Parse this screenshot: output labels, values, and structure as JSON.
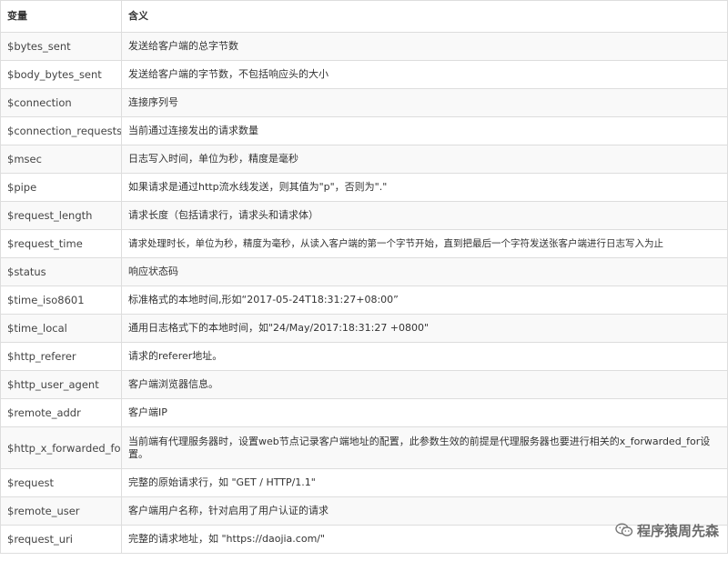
{
  "header": {
    "col1": "变量",
    "col2": "含义"
  },
  "rows": [
    {
      "var": "$bytes_sent",
      "desc": "发送给客户端的总字节数"
    },
    {
      "var": "$body_bytes_sent",
      "desc": "发送给客户端的字节数，不包括响应头的大小"
    },
    {
      "var": "$connection",
      "desc": "连接序列号"
    },
    {
      "var": "$connection_requests",
      "desc": "当前通过连接发出的请求数量"
    },
    {
      "var": "$msec",
      "desc": "日志写入时间，单位为秒，精度是毫秒"
    },
    {
      "var": "$pipe",
      "desc": "如果请求是通过http流水线发送，则其值为\"p\"，否则为\".\""
    },
    {
      "var": "$request_length",
      "desc": "请求长度（包括请求行，请求头和请求体）"
    },
    {
      "var": "$request_time",
      "desc": "请求处理时长，单位为秒，精度为毫秒，从读入客户端的第一个字节开始，直到把最后一个字符发送张客户端进行日志写入为止"
    },
    {
      "var": "$status",
      "desc": "响应状态码"
    },
    {
      "var": "$time_iso8601",
      "desc": "标准格式的本地时间,形如“2017-05-24T18:31:27+08:00”"
    },
    {
      "var": "$time_local",
      "desc": "通用日志格式下的本地时间，如\"24/May/2017:18:31:27 +0800\""
    },
    {
      "var": "$http_referer",
      "desc": "请求的referer地址。"
    },
    {
      "var": "$http_user_agent",
      "desc": "客户端浏览器信息。"
    },
    {
      "var": "$remote_addr",
      "desc": "客户端IP"
    },
    {
      "var": "$http_x_forwarded_for",
      "desc": "当前端有代理服务器时，设置web节点记录客户端地址的配置，此参数生效的前提是代理服务器也要进行相关的x_forwarded_for设置。"
    },
    {
      "var": "$request",
      "desc": "完整的原始请求行，如 \"GET / HTTP/1.1\""
    },
    {
      "var": "$remote_user",
      "desc": "客户端用户名称，针对启用了用户认证的请求"
    },
    {
      "var": "$request_uri",
      "desc": "完整的请求地址，如 \"https://daojia.com/\""
    }
  ],
  "watermark": {
    "text": "程序猿周先森",
    "icon": "wechat-icon"
  }
}
